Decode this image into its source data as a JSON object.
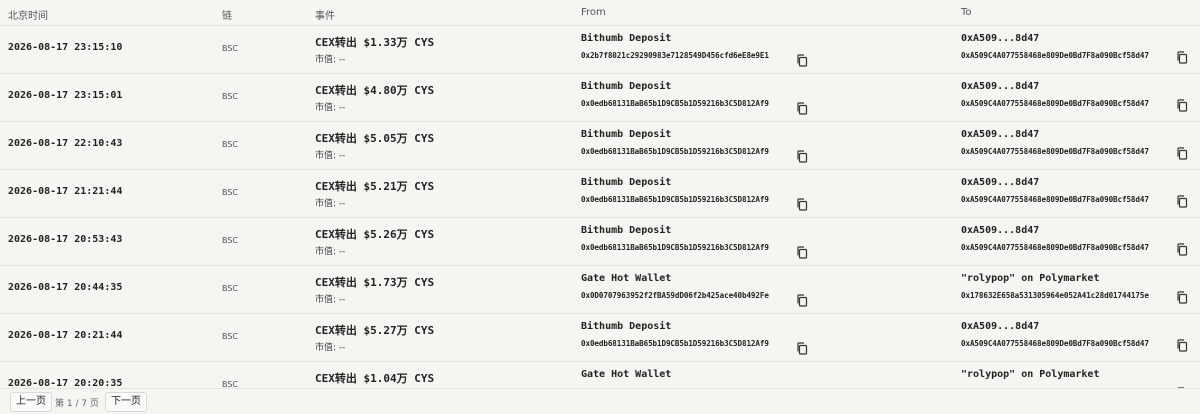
{
  "header": {
    "time": "北京时间",
    "chain": "链",
    "event": "事件",
    "from": "From",
    "to": "To"
  },
  "rows": [
    {
      "time": "2026-08-17 23:15:10",
      "chain": "BSC",
      "event": "CEX转出 $1.33万 CYS",
      "mcap": "市值: --",
      "from_name": "Bithumb Deposit",
      "from_addr": "0x2b7f8021c29290983e7128549D456cfd6eE8e9E1",
      "to_name": "0xA509...8d47",
      "to_addr": "0xA509C4A077558468e809De0Bd7F8a090Bcf58d47"
    },
    {
      "time": "2026-08-17 23:15:01",
      "chain": "BSC",
      "event": "CEX转出 $4.80万 CYS",
      "mcap": "市值: --",
      "from_name": "Bithumb Deposit",
      "from_addr": "0x0edb68131BaB65b1D9CB5b1D59216b3C5D812Af9",
      "to_name": "0xA509...8d47",
      "to_addr": "0xA509C4A077558468e809De0Bd7F8a090Bcf58d47"
    },
    {
      "time": "2026-08-17 22:10:43",
      "chain": "BSC",
      "event": "CEX转出 $5.05万 CYS",
      "mcap": "市值: --",
      "from_name": "Bithumb Deposit",
      "from_addr": "0x0edb68131BaB65b1D9CB5b1D59216b3C5D812Af9",
      "to_name": "0xA509...8d47",
      "to_addr": "0xA509C4A077558468e809De0Bd7F8a090Bcf58d47"
    },
    {
      "time": "2026-08-17 21:21:44",
      "chain": "BSC",
      "event": "CEX转出 $5.21万 CYS",
      "mcap": "市值: --",
      "from_name": "Bithumb Deposit",
      "from_addr": "0x0edb68131BaB65b1D9CB5b1D59216b3C5D812Af9",
      "to_name": "0xA509...8d47",
      "to_addr": "0xA509C4A077558468e809De0Bd7F8a090Bcf58d47"
    },
    {
      "time": "2026-08-17 20:53:43",
      "chain": "BSC",
      "event": "CEX转出 $5.26万 CYS",
      "mcap": "市值: --",
      "from_name": "Bithumb Deposit",
      "from_addr": "0x0edb68131BaB65b1D9CB5b1D59216b3C5D812Af9",
      "to_name": "0xA509...8d47",
      "to_addr": "0xA509C4A077558468e809De0Bd7F8a090Bcf58d47"
    },
    {
      "time": "2026-08-17 20:44:35",
      "chain": "BSC",
      "event": "CEX转出 $1.73万 CYS",
      "mcap": "市值: --",
      "from_name": "Gate Hot Wallet",
      "from_addr": "0x0D0707963952f2fBA59dD06f2b425ace40b492Fe",
      "to_name": "\"rolypop\" on Polymarket",
      "to_addr": "0x178632E658a531305964e052A41c28d01744175e"
    },
    {
      "time": "2026-08-17 20:21:44",
      "chain": "BSC",
      "event": "CEX转出 $5.27万 CYS",
      "mcap": "市值: --",
      "from_name": "Bithumb Deposit",
      "from_addr": "0x0edb68131BaB65b1D9CB5b1D59216b3C5D812Af9",
      "to_name": "0xA509...8d47",
      "to_addr": "0xA509C4A077558468e809De0Bd7F8a090Bcf58d47"
    },
    {
      "time": "2026-08-17 20:20:35",
      "chain": "BSC",
      "event": "CEX转出 $1.04万 CYS",
      "mcap": "",
      "from_name": "Gate Hot Wallet",
      "from_addr": "",
      "to_name": "\"rolypop\" on Polymarket",
      "to_addr": ""
    }
  ],
  "pagination": {
    "prev_label": "上一页",
    "page_info": "第 1 / 7 页",
    "next_label": "下一页"
  }
}
